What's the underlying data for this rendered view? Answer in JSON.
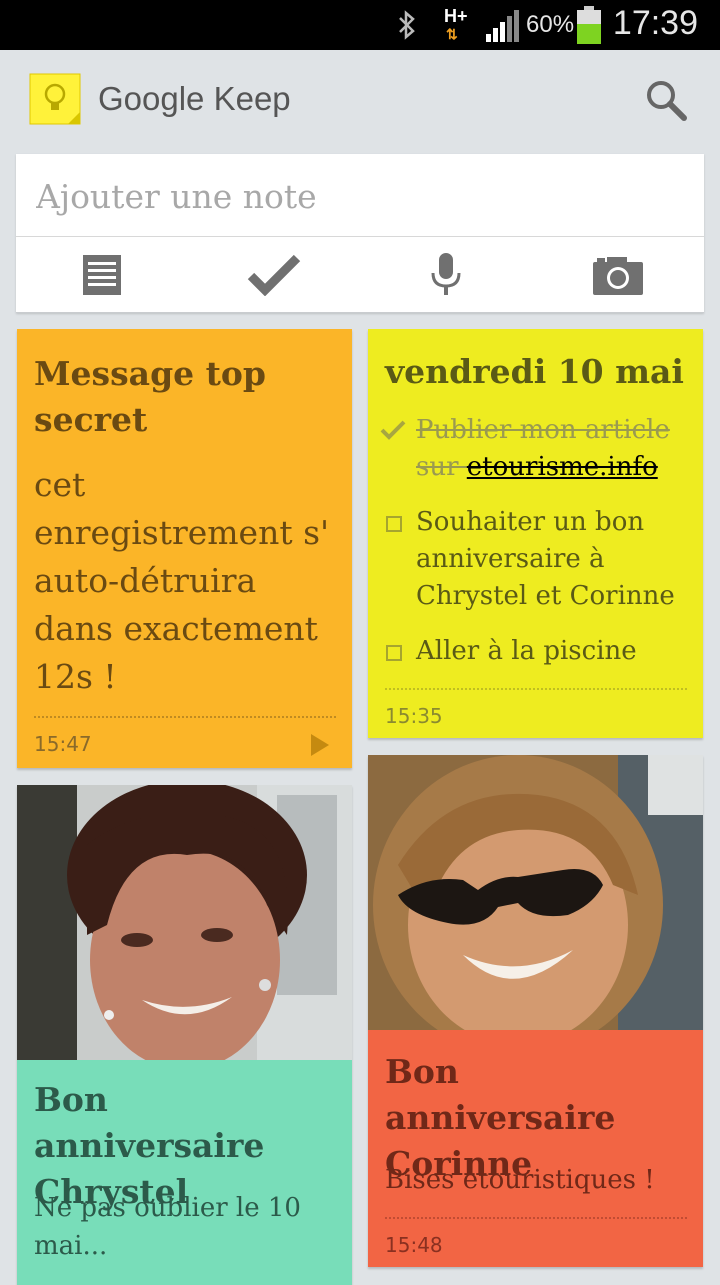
{
  "status_bar": {
    "network": "H+",
    "battery_percent": "60%",
    "time": "17:39"
  },
  "app": {
    "title": "Google Keep"
  },
  "new_note": {
    "placeholder": "Ajouter une note",
    "tools": [
      "text-note-icon",
      "checklist-icon",
      "microphone-icon",
      "camera-icon"
    ]
  },
  "notes": {
    "top_secret": {
      "title": "Message top secret",
      "body": "cet enregistrement s' auto-détruira dans exactement 12s !",
      "time": "15:47",
      "color": "#fbb528"
    },
    "friday": {
      "title": "vendredi 10 mai",
      "items": [
        {
          "text_prefix": "Publier mon article sur ",
          "link": "etourisme.info",
          "checked": true
        },
        {
          "text": "Souhaiter un bon anniversaire à Chrystel et Corinne",
          "checked": false
        },
        {
          "text": "Aller à la piscine",
          "checked": false
        }
      ],
      "time": "15:35",
      "color": "#eeec20"
    },
    "chrystel": {
      "title": "Bon anniversaire Chrystel",
      "body": "Ne pas oublier le 10 mai...",
      "color": "#78ddb9"
    },
    "corinne": {
      "title": "Bon anniversaire Corinne",
      "body": "Bises etouristiques !",
      "time": "15:48",
      "color": "#f26544"
    }
  }
}
